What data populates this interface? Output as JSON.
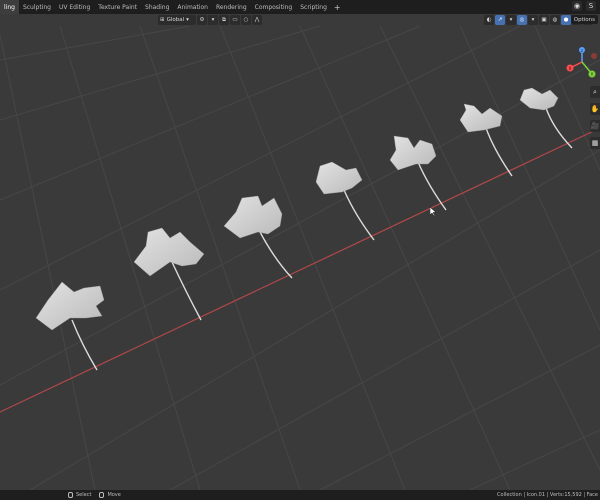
{
  "workspace_tabs": [
    {
      "label": "ling",
      "active": true
    },
    {
      "label": "Sculpting",
      "active": false
    },
    {
      "label": "UV Editing",
      "active": false
    },
    {
      "label": "Texture Paint",
      "active": false
    },
    {
      "label": "Shading",
      "active": false
    },
    {
      "label": "Animation",
      "active": false
    },
    {
      "label": "Rendering",
      "active": false
    },
    {
      "label": "Compositing",
      "active": false
    },
    {
      "label": "Scripting",
      "active": false
    }
  ],
  "add_workspace": "+",
  "header": {
    "transform_orientation": "Global",
    "options_label": "Options"
  },
  "gizmo": {
    "axis_y": "Y",
    "axis_x": "X",
    "axis_z": "Z"
  },
  "status": {
    "select_label": "Select",
    "move_label": "Move",
    "stats_text": "Collection | Icon.01 | Verts:15,592 | Face"
  },
  "colors": {
    "viewport_bg": "#3a3a3a",
    "grid": "#474747",
    "x_axis": "#b04848",
    "leaf": "#d4d4d4",
    "accent_blue": "#4672b4"
  },
  "icons": [
    "editor-type-icon",
    "transform-pivot-icon",
    "snap-icon",
    "proportional-edit-icon",
    "visibility-icon",
    "gizmo-toggle-icon",
    "overlay-icon",
    "xray-icon",
    "shading-solid-icon",
    "zoom-icon",
    "pan-icon",
    "camera-icon",
    "grid-view-icon",
    "mouse-left-icon",
    "mouse-middle-icon"
  ]
}
